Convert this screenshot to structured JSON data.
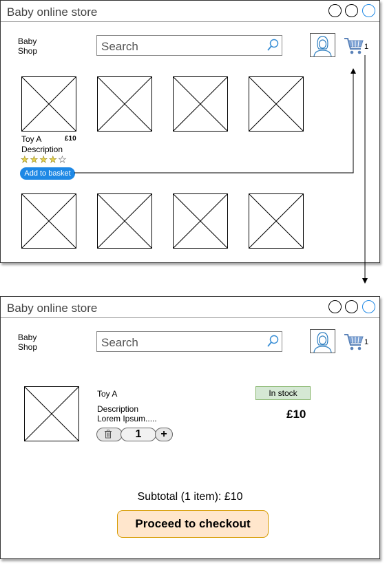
{
  "listing_window": {
    "title": "Baby online store",
    "logo": [
      "Baby",
      "Shop"
    ],
    "search_placeholder": "Search",
    "cart_count": "1",
    "product": {
      "name": "Toy A",
      "price": "£10",
      "description": "Description",
      "rating": 4,
      "rating_max": 5,
      "add_button": "Add to basket"
    }
  },
  "basket_window": {
    "title": "Baby online store",
    "logo": [
      "Baby",
      "Shop"
    ],
    "search_placeholder": "Search",
    "cart_count": "1",
    "item": {
      "name": "Toy A",
      "description": "Description",
      "lorem": "Lorem Ipsum.....",
      "stock_status": "In stock",
      "price": "£10",
      "quantity": "1"
    },
    "subtotal": "Subtotal (1 item): £10",
    "checkout_button": "Proceed to checkout"
  },
  "colors": {
    "accent_blue": "#1e88e5",
    "stock_green": "#d5e8d4",
    "checkout_orange": "#ffe6cc"
  }
}
